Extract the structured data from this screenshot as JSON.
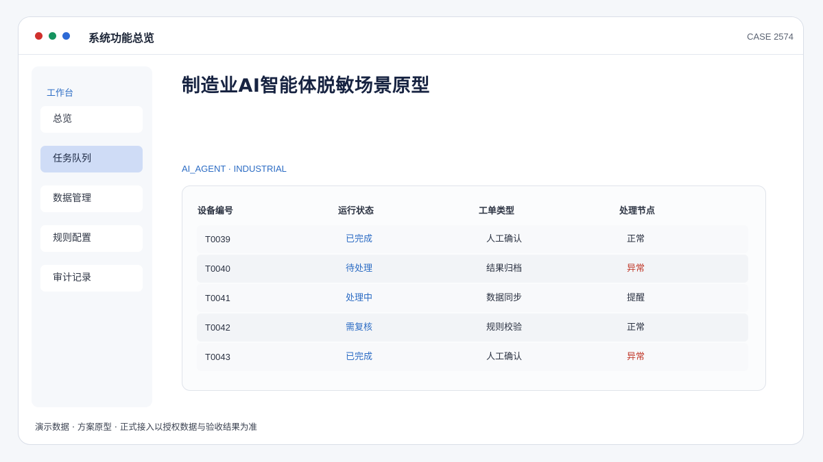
{
  "window": {
    "title": "系统功能总览",
    "case_id": "CASE 2574"
  },
  "sidebar": {
    "heading": "工作台",
    "items": [
      {
        "label": "总览",
        "active": false
      },
      {
        "label": "任务队列",
        "active": true
      },
      {
        "label": "数据管理",
        "active": false
      },
      {
        "label": "规则配置",
        "active": false
      },
      {
        "label": "审计记录",
        "active": false
      }
    ]
  },
  "main": {
    "title": "制造业AI智能体脱敏场景原型",
    "subtitle": "AI_AGENT · INDUSTRIAL"
  },
  "table": {
    "columns": [
      "设备编号",
      "运行状态",
      "工单类型",
      "处理节点"
    ],
    "rows": [
      {
        "id": "T0039",
        "status": "已完成",
        "type": "人工确认",
        "node": "正常"
      },
      {
        "id": "T0040",
        "status": "待处理",
        "type": "结果归档",
        "node": "异常"
      },
      {
        "id": "T0041",
        "status": "处理中",
        "type": "数据同步",
        "node": "提醒"
      },
      {
        "id": "T0042",
        "status": "需复核",
        "type": "规则校验",
        "node": "正常"
      },
      {
        "id": "T0043",
        "status": "已完成",
        "type": "人工确认",
        "node": "异常"
      }
    ]
  },
  "footer": {
    "note": "演示数据 · 方案原型 · 正式接入以授权数据与验收结果为准"
  },
  "colors": {
    "accent": "#2c6cc4",
    "alert": "#c0392b",
    "dot_red": "#d0312d",
    "dot_green": "#15935f",
    "dot_blue": "#2d6ad6"
  }
}
